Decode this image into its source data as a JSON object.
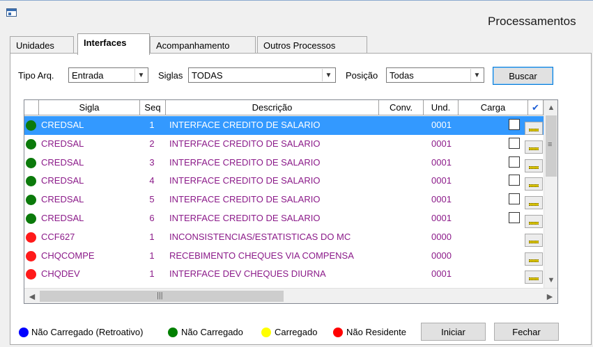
{
  "window": {
    "title": "Processamentos"
  },
  "tabs": [
    {
      "label": "Unidades",
      "active": false
    },
    {
      "label": "Interfaces",
      "active": true
    },
    {
      "label": "Acompanhamento",
      "active": false
    },
    {
      "label": "Outros Processos",
      "active": false
    }
  ],
  "filters": {
    "tipo_label": "Tipo Arq.",
    "tipo_value": "Entrada",
    "siglas_label": "Siglas",
    "siglas_value": "TODAS",
    "posicao_label": "Posição",
    "posicao_value": "Todas",
    "buscar_label": "Buscar"
  },
  "grid": {
    "columns": [
      "Sigla",
      "Seq",
      "Descrição",
      "Conv.",
      "Und.",
      "Carga",
      "✔"
    ],
    "rows": [
      {
        "sigla": "CREDSAL",
        "seq": "1",
        "descricao": "INTERFACE CREDITO DE SALARIO",
        "conv": "",
        "und": "0001",
        "carga": "",
        "status": "green",
        "checkbox": true
      },
      {
        "sigla": "CREDSAL",
        "seq": "2",
        "descricao": "INTERFACE CREDITO DE SALARIO",
        "conv": "",
        "und": "0001",
        "carga": "",
        "status": "green",
        "checkbox": true
      },
      {
        "sigla": "CREDSAL",
        "seq": "3",
        "descricao": "INTERFACE CREDITO DE SALARIO",
        "conv": "",
        "und": "0001",
        "carga": "",
        "status": "green",
        "checkbox": true
      },
      {
        "sigla": "CREDSAL",
        "seq": "4",
        "descricao": "INTERFACE CREDITO DE SALARIO",
        "conv": "",
        "und": "0001",
        "carga": "",
        "status": "green",
        "checkbox": true
      },
      {
        "sigla": "CREDSAL",
        "seq": "5",
        "descricao": "INTERFACE CREDITO DE SALARIO",
        "conv": "",
        "und": "0001",
        "carga": "",
        "status": "green",
        "checkbox": true
      },
      {
        "sigla": "CREDSAL",
        "seq": "6",
        "descricao": "INTERFACE CREDITO DE SALARIO",
        "conv": "",
        "und": "0001",
        "carga": "",
        "status": "green",
        "checkbox": true
      },
      {
        "sigla": "CCF627",
        "seq": "1",
        "descricao": "INCONSISTENCIAS/ESTATISTICAS DO MC",
        "conv": "",
        "und": "0000",
        "carga": "",
        "status": "red",
        "checkbox": false
      },
      {
        "sigla": "CHQCOMPE",
        "seq": "1",
        "descricao": "RECEBIMENTO CHEQUES VIA COMPENSA",
        "conv": "",
        "und": "0000",
        "carga": "",
        "status": "red",
        "checkbox": false
      },
      {
        "sigla": "CHQDEV",
        "seq": "1",
        "descricao": "INTERFACE DEV CHEQUES DIURNA",
        "conv": "",
        "und": "0001",
        "carga": "",
        "status": "red",
        "checkbox": false
      }
    ],
    "selected_row": 0
  },
  "legend": [
    {
      "label": "Não Carregado (Retroativo)",
      "color": "#0000ff"
    },
    {
      "label": "Não Carregado",
      "color": "#008000"
    },
    {
      "label": "Carregado",
      "color": "#ffff00"
    },
    {
      "label": "Não Residente",
      "color": "#ff0000"
    }
  ],
  "buttons": {
    "iniciar_label": "Iniciar",
    "fechar_label": "Fechar"
  },
  "colors": {
    "green": "#0b7a0b",
    "red": "#ff1a1a",
    "selection": "#3399ff",
    "row_text": "#8b1a89"
  }
}
